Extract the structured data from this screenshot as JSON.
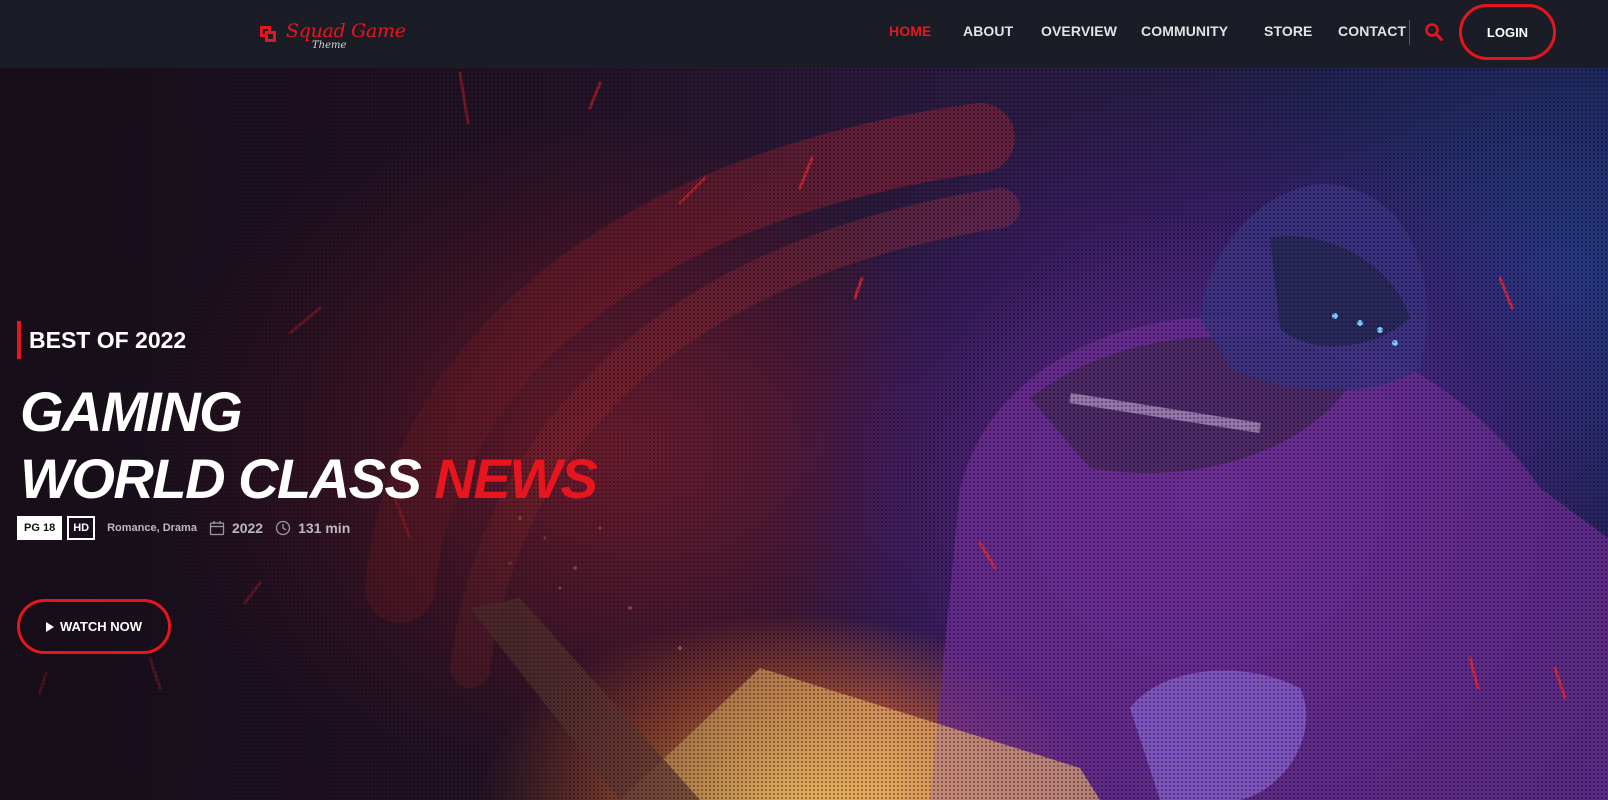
{
  "brand": {
    "name": "Squad Game",
    "subtitle": "Theme",
    "accent_color": "#e7151d"
  },
  "nav": {
    "items": [
      {
        "label": "HOME",
        "active": true
      },
      {
        "label": "ABOUT",
        "active": false
      },
      {
        "label": "OVERVIEW",
        "active": false
      },
      {
        "label": "COMMUNITY",
        "active": false
      },
      {
        "label": "STORE",
        "active": false
      },
      {
        "label": "CONTACT",
        "active": false
      }
    ],
    "search_icon": "search-icon",
    "login_label": "LOGIN"
  },
  "hero": {
    "tagline": "BEST OF 2022",
    "headline_line1": "GAMING",
    "headline_line2": "WORLD CLASS",
    "headline_accent": "NEWS",
    "rating_badge": "PG 18",
    "quality_badge": "HD",
    "genres": "Romance, Drama",
    "year": "2022",
    "year_icon": "calendar-icon",
    "duration": "131 min",
    "duration_icon": "clock-icon",
    "cta_label": "WATCH NOW",
    "cta_icon": "play-icon"
  }
}
